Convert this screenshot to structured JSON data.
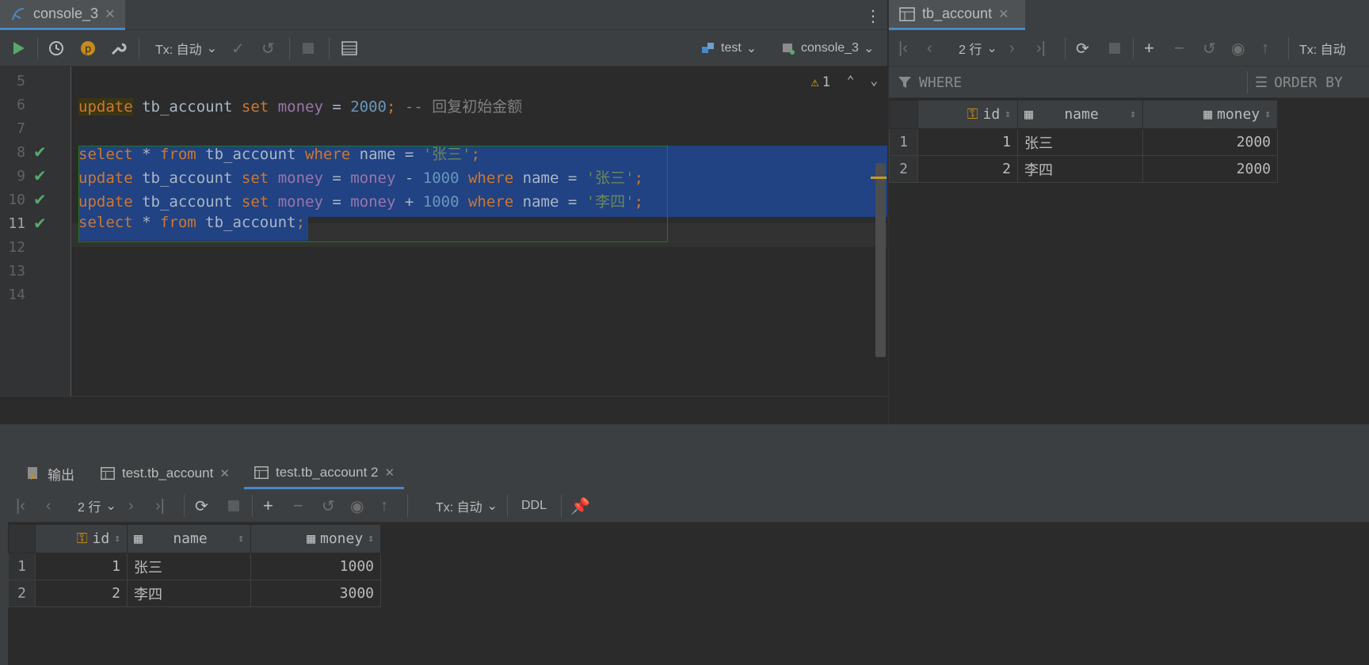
{
  "editor": {
    "tab": {
      "label": "console_3",
      "icon": "sql-console-icon"
    },
    "toolbar": {
      "tx_label": "Tx: 自动",
      "datasource": "test",
      "session": "console_3"
    },
    "warnings": {
      "count": "1"
    },
    "line_numbers": [
      "5",
      "6",
      "7",
      "8",
      "9",
      "10",
      "11",
      "12",
      "13",
      "14"
    ],
    "lines": [
      {
        "n": "5",
        "segments": []
      },
      {
        "n": "6",
        "segments": [
          {
            "t": "update",
            "c": "kw hl-kw"
          },
          {
            "t": " tb_account ",
            "c": ""
          },
          {
            "t": "set",
            "c": "kw"
          },
          {
            "t": " ",
            "c": ""
          },
          {
            "t": "money",
            "c": "col"
          },
          {
            "t": " = ",
            "c": ""
          },
          {
            "t": "2000",
            "c": "num"
          },
          {
            "t": ";",
            "c": "kw"
          },
          {
            "t": " -- 回复初始金额",
            "c": "cmt"
          }
        ]
      },
      {
        "n": "7",
        "segments": []
      },
      {
        "n": "8",
        "segments": [
          {
            "t": "select",
            "c": "kw"
          },
          {
            "t": " * ",
            "c": ""
          },
          {
            "t": "from",
            "c": "kw"
          },
          {
            "t": " tb_account ",
            "c": ""
          },
          {
            "t": "where",
            "c": "kw"
          },
          {
            "t": " name = ",
            "c": ""
          },
          {
            "t": "'张三'",
            "c": "str"
          },
          {
            "t": ";",
            "c": "kw"
          }
        ]
      },
      {
        "n": "9",
        "segments": [
          {
            "t": "update",
            "c": "kw"
          },
          {
            "t": " tb_account ",
            "c": ""
          },
          {
            "t": "set",
            "c": "kw"
          },
          {
            "t": " ",
            "c": ""
          },
          {
            "t": "money",
            "c": "col"
          },
          {
            "t": " = ",
            "c": ""
          },
          {
            "t": "money",
            "c": "col"
          },
          {
            "t": " - ",
            "c": ""
          },
          {
            "t": "1000",
            "c": "num"
          },
          {
            "t": " ",
            "c": ""
          },
          {
            "t": "where",
            "c": "kw"
          },
          {
            "t": " name = ",
            "c": ""
          },
          {
            "t": "'张三'",
            "c": "str"
          },
          {
            "t": ";",
            "c": "kw"
          }
        ]
      },
      {
        "n": "10",
        "segments": [
          {
            "t": "update",
            "c": "kw"
          },
          {
            "t": " tb_account ",
            "c": ""
          },
          {
            "t": "set",
            "c": "kw"
          },
          {
            "t": " ",
            "c": ""
          },
          {
            "t": "money",
            "c": "col"
          },
          {
            "t": " = ",
            "c": ""
          },
          {
            "t": "money",
            "c": "col"
          },
          {
            "t": " + ",
            "c": ""
          },
          {
            "t": "1000",
            "c": "num"
          },
          {
            "t": " ",
            "c": ""
          },
          {
            "t": "where",
            "c": "kw"
          },
          {
            "t": " name = ",
            "c": ""
          },
          {
            "t": "'李四'",
            "c": "str"
          },
          {
            "t": ";",
            "c": "kw"
          }
        ]
      },
      {
        "n": "11",
        "segments": [
          {
            "t": "select",
            "c": "kw"
          },
          {
            "t": " * ",
            "c": ""
          },
          {
            "t": "from",
            "c": "kw"
          },
          {
            "t": " tb_account",
            "c": ""
          },
          {
            "t": ";",
            "c": "kw"
          }
        ]
      },
      {
        "n": "12",
        "segments": []
      },
      {
        "n": "13",
        "segments": []
      },
      {
        "n": "14",
        "segments": []
      }
    ],
    "executed_lines": [
      "8",
      "9",
      "10",
      "11"
    ]
  },
  "result_right": {
    "tab": {
      "label": "tb_account"
    },
    "toolbar": {
      "rows_label": "2 行",
      "tx_label": "Tx: 自动"
    },
    "filter": {
      "where": "WHERE",
      "order_by": "ORDER BY"
    },
    "columns": [
      "id",
      "name",
      "money"
    ],
    "rows": [
      {
        "rn": "1",
        "id": "1",
        "name": "张三",
        "money": "2000"
      },
      {
        "rn": "2",
        "id": "2",
        "name": "李四",
        "money": "2000"
      }
    ]
  },
  "bottom_panel": {
    "tabs": [
      {
        "label": "输出",
        "icon": "output-icon",
        "active": false
      },
      {
        "label": "test.tb_account",
        "icon": "table-icon",
        "active": false
      },
      {
        "label": "test.tb_account 2",
        "icon": "table-icon",
        "active": true
      }
    ],
    "toolbar": {
      "rows_label": "2 行",
      "tx_label": "Tx: 自动",
      "ddl_label": "DDL"
    },
    "columns": [
      "id",
      "name",
      "money"
    ],
    "rows": [
      {
        "rn": "1",
        "id": "1",
        "name": "张三",
        "money": "1000"
      },
      {
        "rn": "2",
        "id": "2",
        "name": "李四",
        "money": "3000"
      }
    ]
  },
  "colors": {
    "background": "#2b2b2b",
    "panel": "#3c3f41",
    "selection": "#214283",
    "keyword": "#cc7832",
    "number": "#6897bb",
    "string": "#6a8759",
    "column": "#9876aa",
    "run_green": "#59a869",
    "accent_blue": "#4a88c7"
  }
}
